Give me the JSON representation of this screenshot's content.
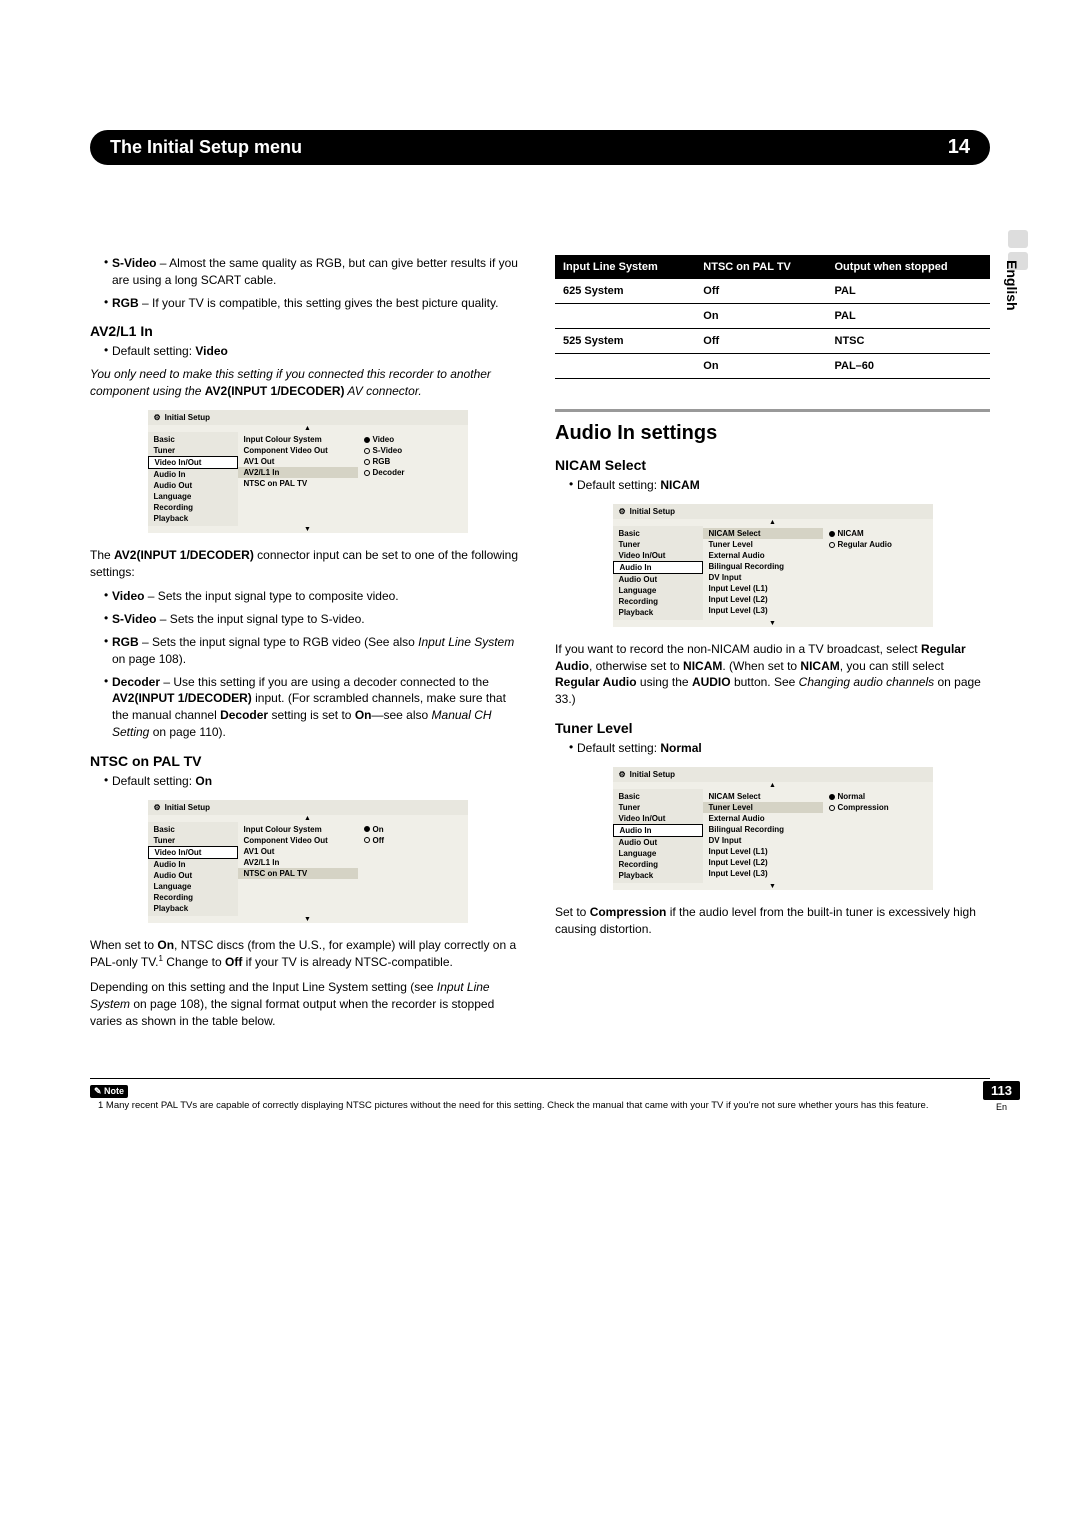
{
  "header": {
    "title": "The Initial Setup menu",
    "chapter": "14"
  },
  "side": {
    "lang": "English"
  },
  "left": {
    "svideo": {
      "label": "S-Video",
      "text": " – Almost the same quality as RGB, but can give better results if you are using a long SCART cable."
    },
    "rgb": {
      "label": "RGB",
      "text": " – If your TV is compatible, this setting gives the best picture quality."
    },
    "av2": {
      "heading": "AV2/L1 In",
      "default_label": "Default setting: ",
      "default_value": "Video",
      "note1": "You only need to make this setting if you connected this recorder to another component using the ",
      "note1b": "AV2(INPUT 1/DECODER)",
      "note1c": " AV connector."
    },
    "osd1": {
      "title": "Initial Setup",
      "left": [
        "Basic",
        "Tuner",
        "Video In/Out",
        "Audio In",
        "Audio Out",
        "Language",
        "Recording",
        "Playback"
      ],
      "mid": [
        "Input Colour System",
        "Component Video Out",
        "AV1 Out",
        "AV2/L1 In",
        "NTSC on PAL TV"
      ],
      "right": [
        "Video",
        "S-Video",
        "RGB",
        "Decoder"
      ],
      "sel_left": "Video In/Out",
      "hl_mid": "AV2/L1 In",
      "sel_right": "Video"
    },
    "after_osd1a": "The ",
    "after_osd1b": "AV2(INPUT 1/DECODER)",
    "after_osd1c": " connector input can be set to one of the following settings:",
    "opts": {
      "video": {
        "label": "Video",
        "text": " – Sets the input signal type to composite video."
      },
      "svideo": {
        "label": "S-Video",
        "text": " – Sets the input signal type to S-video."
      },
      "rgb": {
        "label": "RGB",
        "text_a": " – Sets the input signal type to RGB video (See also ",
        "text_i": "Input Line System",
        "text_b": " on page 108)."
      },
      "decoder": {
        "label": "Decoder",
        "t1": " – Use this setting if you are using a decoder connected to the ",
        "t1b": "AV2(INPUT 1/DECODER)",
        "t2": " input. (For scrambled channels, make sure that the manual channel ",
        "t2b": "Decoder",
        "t3": " setting is set to ",
        "t3b": "On",
        "t4": "—see also ",
        "t4i": "Manual CH Setting",
        "t5": " on page 110)."
      }
    },
    "ntsc": {
      "heading": "NTSC on PAL TV",
      "default_label": "Default setting: ",
      "default_value": "On"
    },
    "osd2": {
      "title": "Initial Setup",
      "left": [
        "Basic",
        "Tuner",
        "Video In/Out",
        "Audio In",
        "Audio Out",
        "Language",
        "Recording",
        "Playback"
      ],
      "mid": [
        "Input Colour System",
        "Component Video Out",
        "AV1 Out",
        "AV2/L1 In",
        "NTSC on PAL TV"
      ],
      "right": [
        "On",
        "Off"
      ],
      "sel_left": "Video In/Out",
      "hl_mid": "NTSC on PAL TV",
      "sel_right": "On"
    },
    "after_osd2": {
      "p1a": "When set to ",
      "p1b": "On",
      "p1c": ", NTSC discs (from the U.S., for example) will play correctly on a PAL-only TV.",
      "p1sup": "1",
      "p1d": " Change to ",
      "p1e": "Off",
      "p1f": " if your TV is already NTSC-compatible.",
      "p2a": "Depending on this setting and the Input Line System setting (see ",
      "p2i": "Input Line System",
      "p2b": " on page 108), the signal format output when the recorder is stopped varies as shown in the table below."
    }
  },
  "right": {
    "table": {
      "h1": "Input Line System",
      "h2": "NTSC on PAL TV",
      "h3": "Output when stopped",
      "rows": [
        [
          "625 System",
          "Off",
          "PAL"
        ],
        [
          "",
          "On",
          "PAL"
        ],
        [
          "525 System",
          "Off",
          "NTSC"
        ],
        [
          "",
          "On",
          "PAL–60"
        ]
      ]
    },
    "section": "Audio In settings",
    "nicam": {
      "heading": "NICAM Select",
      "default_label": "Default setting: ",
      "default_value": "NICAM"
    },
    "osd3": {
      "title": "Initial Setup",
      "left": [
        "Basic",
        "Tuner",
        "Video In/Out",
        "Audio In",
        "Audio Out",
        "Language",
        "Recording",
        "Playback"
      ],
      "mid": [
        "NICAM Select",
        "Tuner Level",
        "External Audio",
        "Bilingual Recording",
        "DV Input",
        "Input Level (L1)",
        "Input Level (L2)",
        "Input Level (L3)"
      ],
      "right": [
        "NICAM",
        "Regular Audio"
      ],
      "sel_left": "Audio In",
      "hl_mid": "NICAM Select",
      "sel_right": "NICAM"
    },
    "after_osd3": {
      "a": "If you want to record the non-NICAM audio in a TV broadcast, select ",
      "b": "Regular Audio",
      "c": ", otherwise set to ",
      "d": "NICAM",
      "e": ". (When set to ",
      "f": "NICAM",
      "g": ", you can still select ",
      "h": "Regular Audio",
      "i": " using the ",
      "j": "AUDIO",
      "k": " button. See ",
      "l": "Changing audio channels",
      "m": " on page 33.)"
    },
    "tuner": {
      "heading": "Tuner Level",
      "default_label": "Default setting: ",
      "default_value": "Normal"
    },
    "osd4": {
      "title": "Initial Setup",
      "left": [
        "Basic",
        "Tuner",
        "Video In/Out",
        "Audio In",
        "Audio Out",
        "Language",
        "Recording",
        "Playback"
      ],
      "mid": [
        "NICAM Select",
        "Tuner Level",
        "External Audio",
        "Bilingual Recording",
        "DV Input",
        "Input Level (L1)",
        "Input Level (L2)",
        "Input Level (L3)"
      ],
      "right": [
        "Normal",
        "Compression"
      ],
      "sel_left": "Audio In",
      "hl_mid": "Tuner Level",
      "sel_right": "Normal"
    },
    "after_osd4": {
      "a": "Set to ",
      "b": "Compression",
      "c": " if the audio level from the built-in tuner is excessively high causing distortion."
    }
  },
  "footnote": {
    "label": "Note",
    "text": "1 Many recent PAL TVs are capable of correctly displaying NTSC pictures without the need for this setting. Check the manual that came with your TV if you're not sure whether yours has this feature."
  },
  "page": {
    "num": "113",
    "sub": "En"
  }
}
